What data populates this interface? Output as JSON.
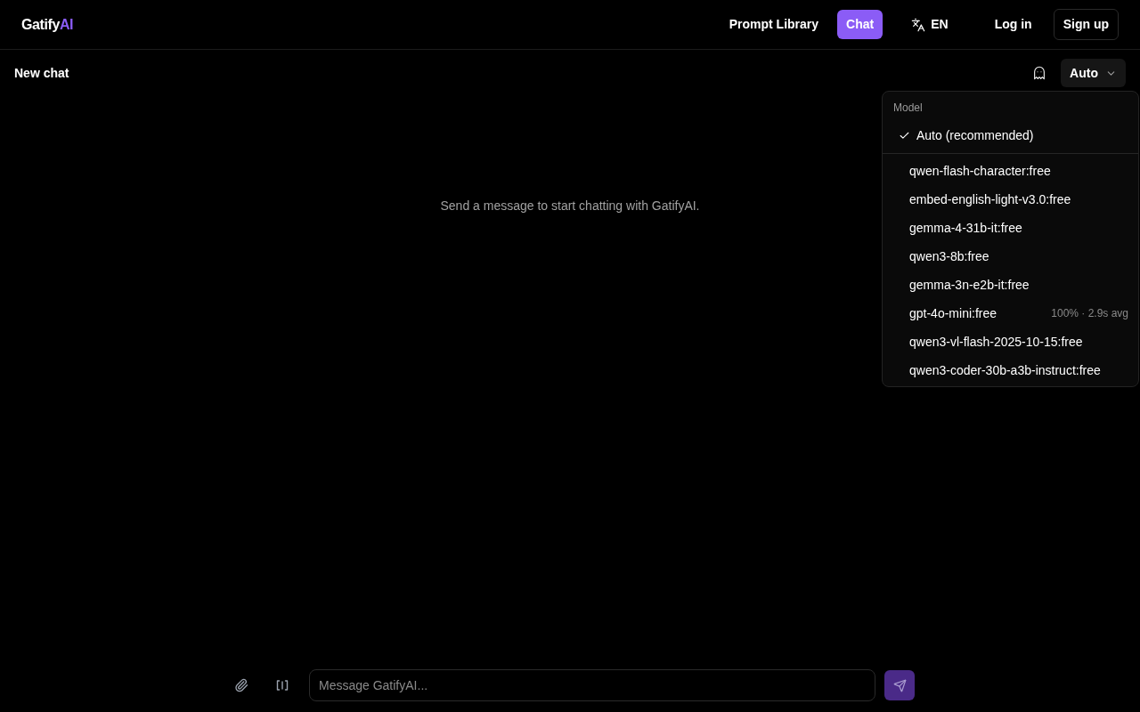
{
  "header": {
    "logo": {
      "text": "Gatify",
      "accent": "AI"
    },
    "nav": [
      {
        "label": "Prompt Library",
        "selected": false
      },
      {
        "label": "Chat",
        "selected": true
      }
    ],
    "language": {
      "label": "EN"
    },
    "auth": [
      {
        "label": "Log in",
        "kind": "ghost"
      },
      {
        "label": "Sign up",
        "kind": "outline"
      }
    ]
  },
  "chat_bar": {
    "title": "New chat",
    "model_select": {
      "value": "Auto"
    }
  },
  "model_menu": {
    "label": "Model",
    "auto_option": {
      "name": "Auto (recommended)",
      "selected": true
    },
    "models": [
      {
        "name": "qwen-flash-character:free",
        "selected": false
      },
      {
        "name": "embed-english-light-v3.0:free",
        "selected": false
      },
      {
        "name": "gemma-4-31b-it:free",
        "selected": false
      },
      {
        "name": "qwen3-8b:free",
        "selected": false
      },
      {
        "name": "gemma-3n-e2b-it:free",
        "selected": false
      },
      {
        "name": "gpt-4o-mini:free",
        "selected": false,
        "stats": "100% · 2.9s avg"
      },
      {
        "name": "qwen3-vl-flash-2025-10-15:free",
        "selected": false
      },
      {
        "name": "qwen3-coder-30b-a3b-instruct:free",
        "selected": false
      }
    ]
  },
  "empty_state": "Send a message to start chatting with GatifyAI.",
  "composer": {
    "placeholder": "Message GatifyAI...",
    "send_disabled": true
  }
}
